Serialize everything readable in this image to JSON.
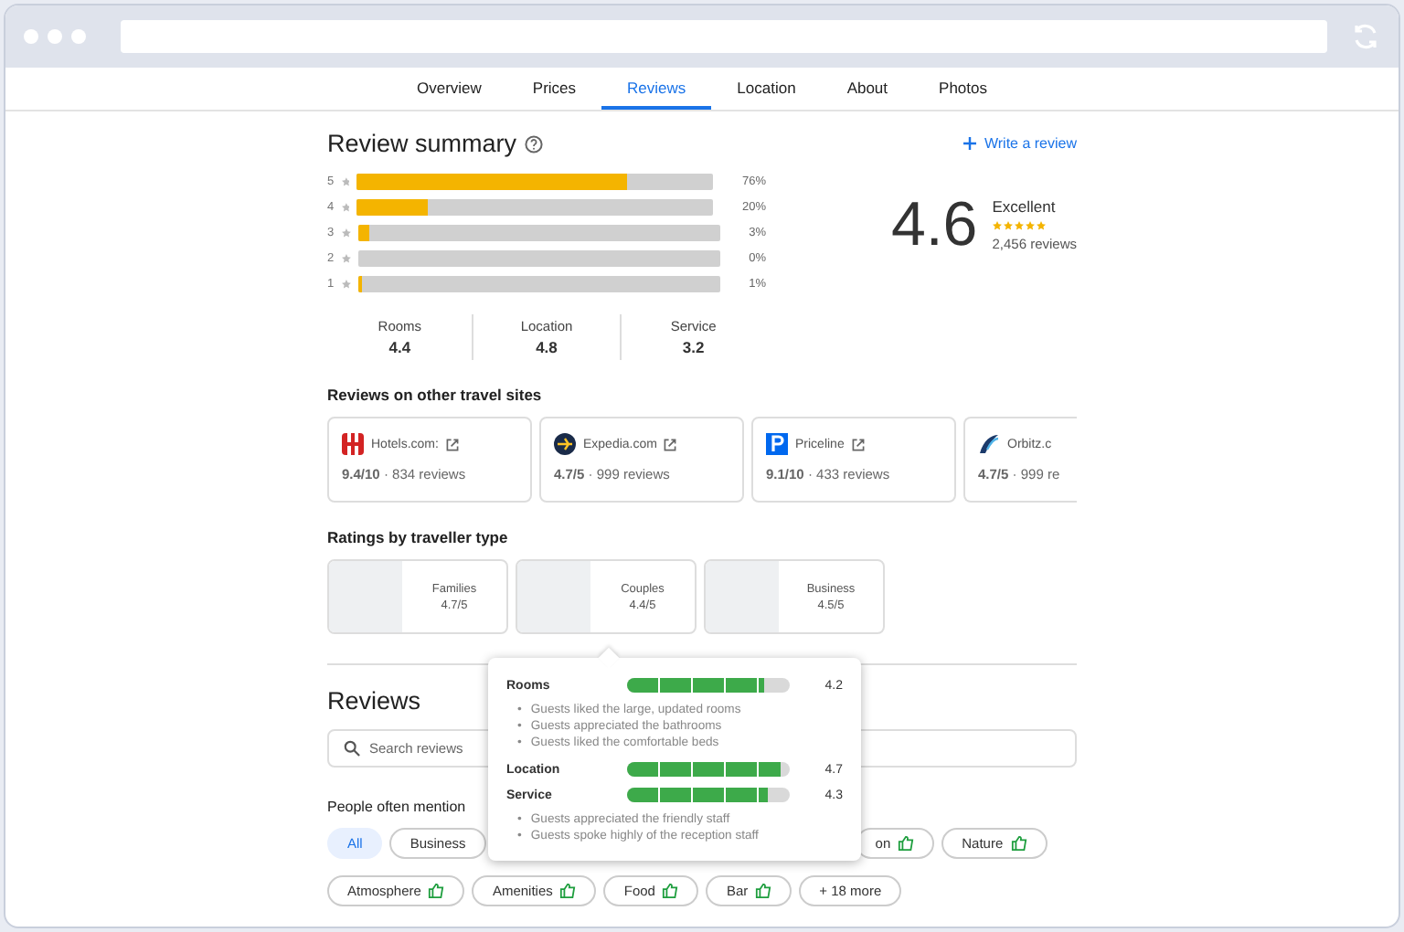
{
  "tabs": [
    {
      "label": "Overview",
      "selected": false
    },
    {
      "label": "Prices",
      "selected": false
    },
    {
      "label": "Reviews",
      "selected": true
    },
    {
      "label": "Location",
      "selected": false
    },
    {
      "label": "About",
      "selected": false
    },
    {
      "label": "Photos",
      "selected": false
    }
  ],
  "summary": {
    "title": "Review summary",
    "write_review": "Write a review",
    "score": "4.6",
    "verdict": "Excellent",
    "stars": 5,
    "count": "2,456 reviews",
    "distribution": [
      {
        "label": "5",
        "level": 0.76,
        "percent": "76%"
      },
      {
        "label": "4",
        "level": 0.2,
        "percent": "20%"
      },
      {
        "label": "3",
        "level": 0.03,
        "percent": "3%"
      },
      {
        "label": "2",
        "level": 0,
        "percent": "0%"
      },
      {
        "label": "1",
        "level": 0.01,
        "percent": "1%"
      }
    ],
    "aspects": [
      {
        "label": "Rooms",
        "value": "4.4"
      },
      {
        "label": "Location",
        "value": "4.8"
      },
      {
        "label": "Service",
        "value": "3.2"
      }
    ]
  },
  "other_sites": {
    "title": "Reviews on other travel sites",
    "sites": [
      {
        "kind": "hotels",
        "name": "Hotels.com:",
        "score": "9.4/10",
        "separator": "·",
        "reviews": "834 reviews",
        "external": true
      },
      {
        "kind": "expedia",
        "name": "Expedia.com",
        "score": "4.7/5",
        "separator": "·",
        "reviews": "999 reviews",
        "external": true
      },
      {
        "kind": "priceline",
        "name": "Priceline",
        "score": "9.1/10",
        "separator": "·",
        "reviews": "433 reviews",
        "external": true
      },
      {
        "kind": "orbitz",
        "name": "Orbitz.c",
        "score": "4.7/5",
        "separator": "·",
        "reviews": "999 re",
        "external": false
      }
    ]
  },
  "traveller_types": {
    "title": "Ratings by traveller type",
    "types": [
      {
        "label": "Families",
        "score": "4.7/5"
      },
      {
        "label": "Couples",
        "score": "4.4/5"
      },
      {
        "label": "Business",
        "score": "4.5/5"
      }
    ]
  },
  "reviews": {
    "title": "Reviews",
    "search": {
      "placeholder": "Search reviews"
    },
    "mention_title": "People often mention",
    "chips": [
      [
        {
          "label": "All",
          "selected": true,
          "liked": false
        },
        {
          "label": "Business",
          "selected": false,
          "liked": false
        },
        {
          "label": "on",
          "selected": false,
          "liked": true
        },
        {
          "label": "Nature",
          "selected": false,
          "liked": true
        }
      ],
      [
        {
          "label": "Atmosphere",
          "selected": false,
          "liked": true
        },
        {
          "label": "Amenities",
          "selected": false,
          "liked": true
        },
        {
          "label": "Food",
          "selected": false,
          "liked": true
        },
        {
          "label": "Bar",
          "selected": false,
          "liked": true
        },
        {
          "label": "+ 18 more",
          "selected": false,
          "liked": false
        }
      ]
    ]
  },
  "popup": {
    "bullet": "•",
    "groups": [
      {
        "label": "Rooms",
        "level": 0.84,
        "value": "4.2",
        "notes": [
          "Guests liked the large, updated rooms",
          "Guests appreciated the bathrooms",
          "Guests liked the comfortable beds"
        ]
      },
      {
        "label": "Location",
        "level": 0.94,
        "value": "4.7"
      },
      {
        "label": "Service",
        "level": 0.86,
        "value": "4.3",
        "notes": [
          "Guests appreciated the friendly staff",
          "Guests spoke highly of the reception staff"
        ]
      }
    ]
  }
}
